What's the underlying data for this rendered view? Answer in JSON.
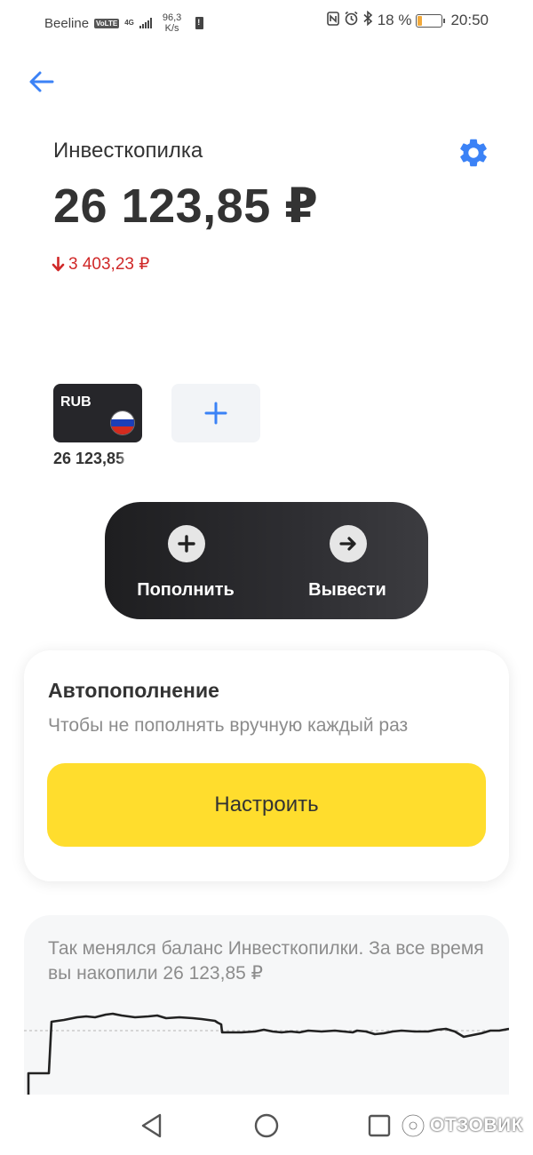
{
  "status_bar": {
    "carrier": "Beeline",
    "volte": "VoLTE",
    "network": "4G",
    "speed_value": "96,3",
    "speed_unit": "K/s",
    "battery_percent": "18 %",
    "battery_level": 0.18,
    "time": "20:50"
  },
  "header": {
    "title": "Инвесткопилка",
    "balance": "26 123,85 ₽",
    "change": "3 403,23 ₽"
  },
  "currencies": [
    {
      "code": "RUB",
      "amount": "26 123,85"
    }
  ],
  "actions": {
    "deposit_label": "Пополнить",
    "withdraw_label": "Вывести"
  },
  "autorefill": {
    "title": "Автопополнение",
    "subtitle": "Чтобы не пополнять вручную каждый раз",
    "button_label": "Настроить"
  },
  "history": {
    "text": "Так менялся баланс Инвесткопилки. За все время вы накопили 26 123,85 ₽"
  },
  "watermark": "ОТЗОВИК",
  "colors": {
    "accent_blue": "#3b82f6",
    "negative_red": "#d02828",
    "button_yellow": "#ffdd2d",
    "dark_card": "#26262a"
  }
}
